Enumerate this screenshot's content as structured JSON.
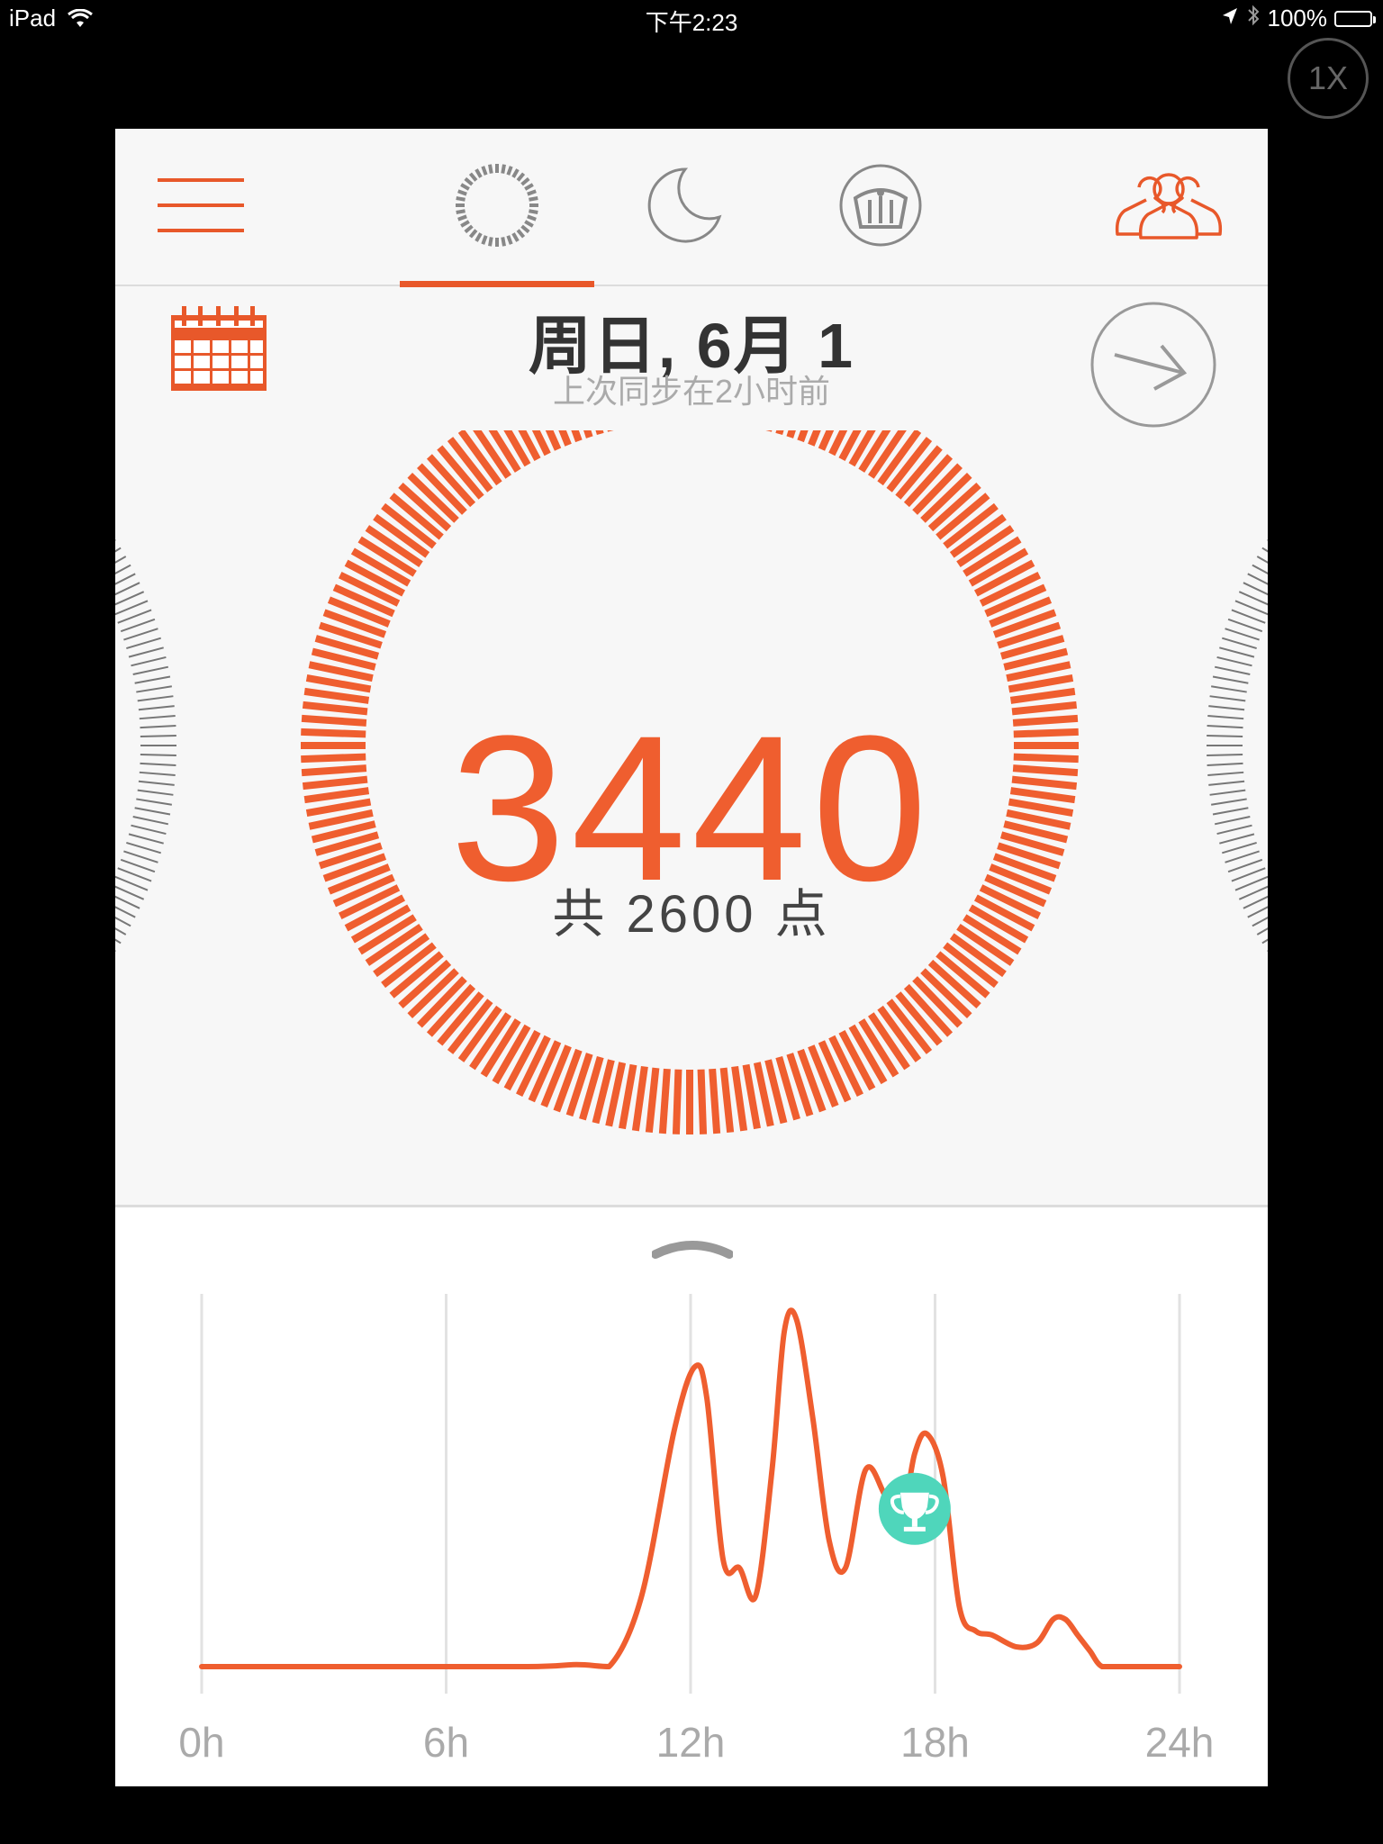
{
  "status_bar": {
    "device": "iPad",
    "time": "下午2:23",
    "battery": "100%"
  },
  "zoom_label": "1X",
  "nav": {
    "tabs": [
      {
        "name": "activity",
        "icon": "activity-ring-icon",
        "selected": true
      },
      {
        "name": "sleep",
        "icon": "moon-icon",
        "selected": false
      },
      {
        "name": "weight",
        "icon": "scale-icon",
        "selected": false
      }
    ],
    "menu_icon": "hamburger-menu-icon",
    "friends_icon": "people-icon"
  },
  "header": {
    "date": "周日, 6月 1",
    "sync_status": "上次同步在2小时前"
  },
  "summary": {
    "points": "3440",
    "goal_text": "共 2600 点",
    "goal": 2600,
    "progress": 1.0
  },
  "colors": {
    "accent": "#ef5e2f",
    "trophy": "#4fd6bb",
    "gray": "#888888"
  },
  "chart_data": {
    "type": "line",
    "x_ticks": [
      "0h",
      "6h",
      "12h",
      "18h",
      "24h"
    ],
    "xlim": [
      0,
      24
    ],
    "ylim": [
      0,
      100
    ],
    "grid": true,
    "series": [
      {
        "x": [
          0,
          4,
          8,
          9.2,
          10,
          10.8,
          11.6,
          12.1,
          12.4,
          12.8,
          13.2,
          13.6,
          14.0,
          14.3,
          14.6,
          15.0,
          15.4,
          15.8,
          16.3,
          16.8,
          17.2,
          17.5,
          17.8,
          18.2,
          18.6,
          19.0,
          19.4,
          20.0,
          20.5,
          20.9,
          21.2,
          21.5,
          21.8,
          22.1,
          22.6,
          24
        ],
        "y": [
          0,
          0,
          0,
          0.5,
          0,
          18,
          60,
          76,
          68,
          27,
          25,
          18,
          50,
          85,
          88,
          63,
          32,
          25,
          50,
          43,
          39,
          54,
          59,
          48,
          15,
          9,
          8,
          5,
          6,
          12,
          12,
          8,
          4,
          0,
          0,
          0
        ]
      }
    ],
    "annotations": [
      {
        "type": "goal-reached-trophy",
        "x": 17.5,
        "y": 40
      }
    ]
  }
}
